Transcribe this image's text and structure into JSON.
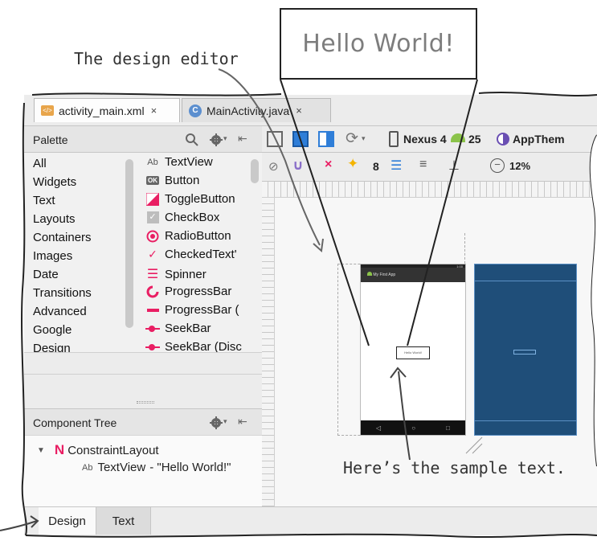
{
  "annotations": {
    "design_editor": "The design editor",
    "sample_text": "Here’s the sample text.",
    "zoom_text": "Hello World!"
  },
  "file_tabs": [
    {
      "label": "activity_main.xml",
      "icon": "xml-file-icon",
      "close": "×",
      "active": true
    },
    {
      "label": "MainActivity.java",
      "icon": "java-class-icon",
      "close": "×",
      "active": false
    }
  ],
  "palette": {
    "title": "Palette",
    "categories": [
      "All",
      "Widgets",
      "Text",
      "Layouts",
      "Containers",
      "Images",
      "Date",
      "Transitions",
      "Advanced",
      "Google",
      "Design"
    ],
    "widgets": [
      {
        "icon": "Ab",
        "label": "TextView"
      },
      {
        "icon": "OK",
        "label": "Button"
      },
      {
        "icon": "toggle",
        "label": "ToggleButton"
      },
      {
        "icon": "checkbox",
        "label": "CheckBox"
      },
      {
        "icon": "radio",
        "label": "RadioButton"
      },
      {
        "icon": "checked-text",
        "label": "CheckedText'"
      },
      {
        "icon": "spinner",
        "label": "Spinner"
      },
      {
        "icon": "progress-circle",
        "label": "ProgressBar"
      },
      {
        "icon": "progress-bar",
        "label": "ProgressBar ("
      },
      {
        "icon": "seekbar",
        "label": "SeekBar"
      },
      {
        "icon": "seekbar-discrete",
        "label": "SeekBar (Disc"
      }
    ]
  },
  "toolbar": {
    "device": "Nexus 4",
    "api": "25",
    "theme": "AppThem",
    "margin": "8",
    "zoom": "12%"
  },
  "component_tree": {
    "title": "Component Tree",
    "root": "ConstraintLayout",
    "child_prefix": "Ab",
    "child": "TextView",
    "child_value": "- \"Hello World!\""
  },
  "phone_preview": {
    "app_title": "My First App",
    "body_text": "Hello World!",
    "status_time": "1:00"
  },
  "bottom_tabs": [
    {
      "label": "Design",
      "active": true
    },
    {
      "label": "Text",
      "active": false
    }
  ],
  "colors": {
    "blueprint": "#1f4e79",
    "accent": "#e91e63",
    "android_green": "#8bc34a"
  }
}
